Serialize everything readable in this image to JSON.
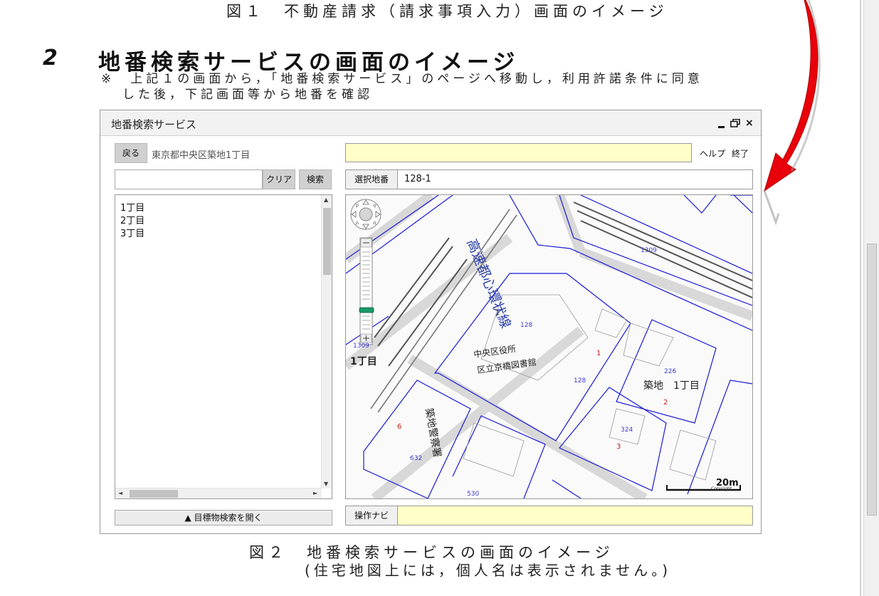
{
  "doc": {
    "fig1_caption": "図１　不動産請求（請求事項入力）画面のイメージ",
    "section_number": "2",
    "section_title": "地番検索サービスの画面のイメージ",
    "note_line1": "※　上記１の画面から，「地番検索サービス」のページへ移動し，利用許諾条件に同意",
    "note_line2": "した後，下記画面等から地番を確認",
    "fig2_caption": "図２　地番検索サービスの画面のイメージ",
    "fig2_sub": "(住宅地図上には，個人名は表示されません。)"
  },
  "window": {
    "title": "地番検索サービス",
    "close_glyph": "×"
  },
  "left": {
    "back_label": "戻る",
    "address": "東京都中央区築地1丁目",
    "search_value": "",
    "clear_label": "クリア",
    "search_label": "検索",
    "list_items": [
      "1丁目",
      "2丁目",
      "3丁目"
    ],
    "landmark_label": "▲ 目標物検索を開く"
  },
  "right": {
    "help_label": "ヘルプ",
    "end_label": "終了",
    "lot_label": "選択地番",
    "lot_value": "128-1",
    "navi_label": "操作ナビ"
  },
  "map": {
    "labels": {
      "expressway": "高速都心環状線",
      "district_1chome": "1丁目",
      "ward_office": "中央区役所",
      "library": "区立京橋図書館",
      "tsukiji": "築地　1丁目",
      "police": "築地警察署",
      "scale": "20m",
      "copyright": "Copyright"
    },
    "lot_numbers": [
      "128",
      "128",
      "1309",
      "1309",
      "226",
      "324",
      "632",
      "530",
      "1",
      "1",
      "2",
      "3",
      "6"
    ]
  }
}
